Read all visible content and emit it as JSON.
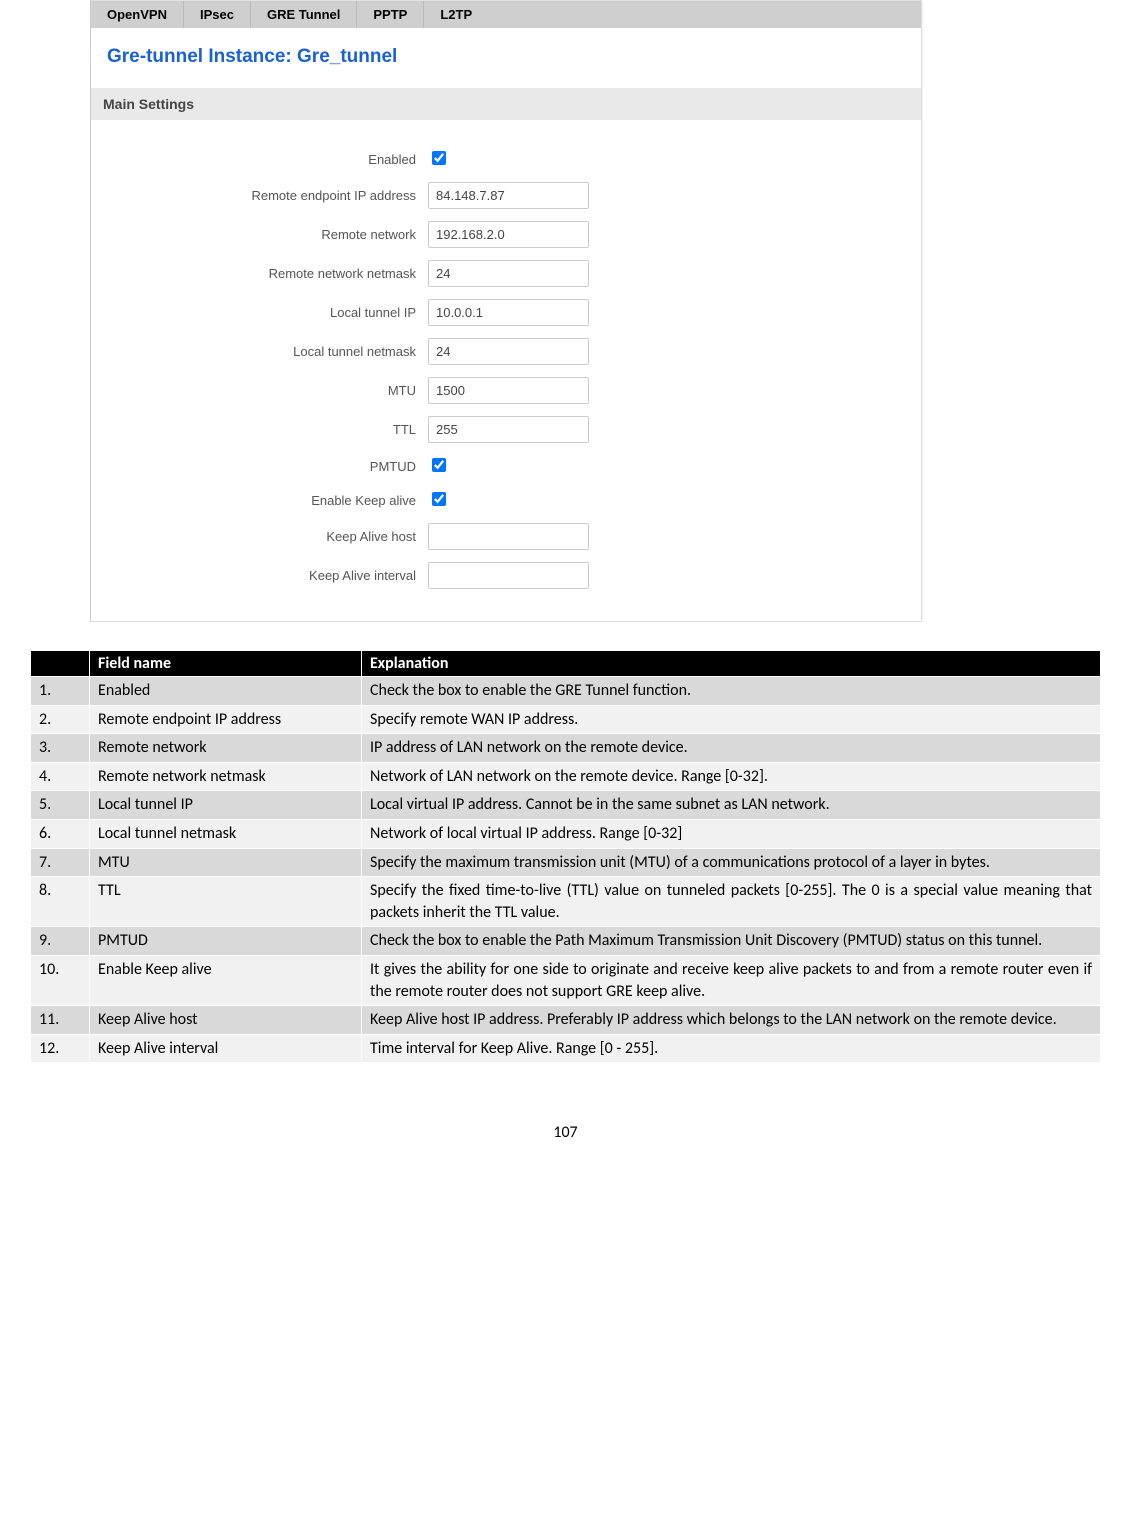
{
  "tabs": [
    "OpenVPN",
    "IPsec",
    "GRE Tunnel",
    "PPTP",
    "L2TP"
  ],
  "title": "Gre-tunnel Instance: Gre_tunnel",
  "section": "Main  Settings",
  "form": {
    "rows": [
      {
        "label": "Enabled",
        "type": "checkbox",
        "checked": true
      },
      {
        "label": "Remote endpoint IP address",
        "type": "text",
        "value": "84.148.7.87"
      },
      {
        "label": "Remote network",
        "type": "text",
        "value": "192.168.2.0"
      },
      {
        "label": "Remote network netmask",
        "type": "text",
        "value": "24"
      },
      {
        "label": "Local tunnel IP",
        "type": "text",
        "value": "10.0.0.1"
      },
      {
        "label": "Local tunnel netmask",
        "type": "text",
        "value": "24"
      },
      {
        "label": "MTU",
        "type": "text",
        "value": "1500"
      },
      {
        "label": "TTL",
        "type": "text",
        "value": "255"
      },
      {
        "label": "PMTUD",
        "type": "checkbox",
        "checked": true
      },
      {
        "label": "Enable Keep alive",
        "type": "checkbox",
        "checked": true
      },
      {
        "label": "Keep Alive host",
        "type": "text",
        "value": ""
      },
      {
        "label": "Keep Alive interval",
        "type": "text",
        "value": ""
      }
    ]
  },
  "table": {
    "headers": [
      "",
      "Field name",
      "Explanation"
    ],
    "rows": [
      {
        "n": "1.",
        "field": "Enabled",
        "explain": "Check the box to enable the GRE Tunnel function."
      },
      {
        "n": "2.",
        "field": "Remote endpoint IP address",
        "explain": "Specify remote WAN IP address."
      },
      {
        "n": "3.",
        "field": "Remote network",
        "explain": "IP address of LAN network on the remote device."
      },
      {
        "n": "4.",
        "field": "Remote network netmask",
        "explain": "Network of LAN network on the remote device. Range [0-32]."
      },
      {
        "n": "5.",
        "field": "Local tunnel IP",
        "explain": "Local virtual IP address. Cannot be in the same subnet as LAN network."
      },
      {
        "n": "6.",
        "field": "Local tunnel netmask",
        "explain": "Network of local virtual IP address. Range [0-32]"
      },
      {
        "n": "7.",
        "field": "MTU",
        "explain": "Specify the maximum transmission unit (MTU) of a communications protocol of a layer in bytes."
      },
      {
        "n": "8.",
        "field": "TTL",
        "explain": "Specify the fixed time-to-live (TTL) value on tunneled packets [0-255]. The 0 is a special value meaning that packets inherit the TTL value."
      },
      {
        "n": "9.",
        "field": "PMTUD",
        "explain": "Check the box to enable the Path Maximum Transmission Unit Discovery (PMTUD) status on this tunnel."
      },
      {
        "n": "10.",
        "field": "Enable Keep alive",
        "explain": "It gives the ability for one side to originate and receive keep alive packets to and from a remote router even if the remote router does not support GRE keep alive."
      },
      {
        "n": "11.",
        "field": "Keep Alive host",
        "explain": "Keep Alive host IP address. Preferably IP address which belongs to the LAN network on the remote device."
      },
      {
        "n": "12.",
        "field": "Keep Alive interval",
        "explain": "Time interval for Keep Alive. Range [0 - 255]."
      }
    ]
  },
  "page_number": "107"
}
